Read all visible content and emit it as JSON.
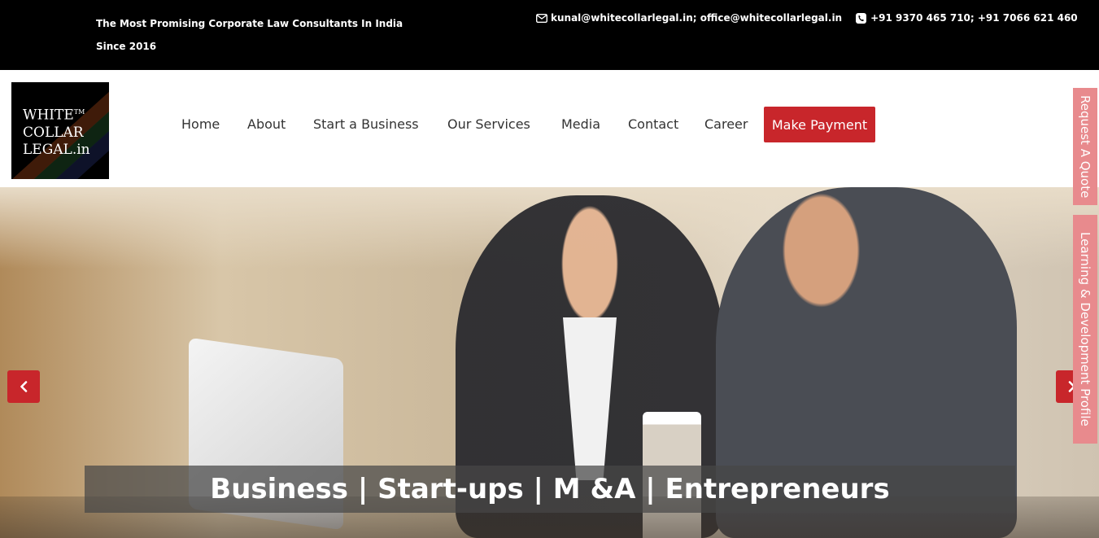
{
  "topbar": {
    "tagline_line1": "The Most Promising Corporate Law Consultants In India",
    "tagline_line2": "Since 2016",
    "email_icon": "envelope-icon",
    "emails": "kunal@whitecollarlegal.in;  office@whitecollarlegal.in",
    "phone_icon": "phone-icon",
    "phones": "+91 9370 465 710; +91 7066 621 460"
  },
  "logo": {
    "line1": "WHITE",
    "tm": "TM",
    "line2": "COLLAR",
    "line3": "LEGAL.in"
  },
  "nav": {
    "items": [
      "Home",
      "About",
      "Start a Business",
      "Our Services",
      "Media",
      "Contact",
      "Career"
    ],
    "payment_label": "Make Payment"
  },
  "hero": {
    "caption": "Business | Start-ups | M &A | Entrepreneurs",
    "prev_icon": "chevron-left-icon",
    "next_icon": "chevron-right-icon"
  },
  "side_tabs": {
    "quote": "Request A Quote",
    "profile": "Learning & Development Profile"
  },
  "colors": {
    "accent": "#c8262b",
    "topbar": "#000000",
    "side_tab": "#e88a8d"
  }
}
